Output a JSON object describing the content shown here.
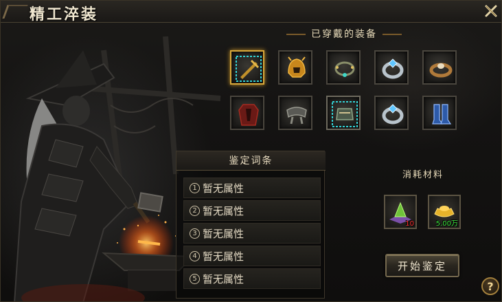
{
  "window": {
    "title": "精工淬装",
    "close_icon": "close-x-icon"
  },
  "equipment": {
    "header": "已穿戴的装备",
    "slots": [
      {
        "icon": "weapon-icon",
        "selected": true
      },
      {
        "icon": "helmet-icon",
        "selected": false
      },
      {
        "icon": "necklace-icon",
        "selected": false
      },
      {
        "icon": "bracelet-icon",
        "selected": false
      },
      {
        "icon": "ring-icon",
        "selected": false
      },
      {
        "icon": "armor-icon",
        "selected": false
      },
      {
        "icon": "belt-icon",
        "selected": false
      },
      {
        "icon": "gauntlet-icon",
        "selected": false
      },
      {
        "icon": "bracer-icon",
        "selected": false
      },
      {
        "icon": "boots-icon",
        "selected": false
      }
    ]
  },
  "attributes": {
    "header": "鉴定词条",
    "rows": [
      {
        "num": "1",
        "text": "暂无属性"
      },
      {
        "num": "2",
        "text": "暂无属性"
      },
      {
        "num": "3",
        "text": "暂无属性"
      },
      {
        "num": "4",
        "text": "暂无属性"
      },
      {
        "num": "5",
        "text": "暂无属性"
      }
    ]
  },
  "materials": {
    "header": "消耗材料",
    "items": [
      {
        "icon": "crystal-pile-icon",
        "count": "10",
        "count_color": "#ff3030"
      },
      {
        "icon": "gold-ingot-icon",
        "count": "5.00万",
        "count_color": "#39e03a"
      }
    ]
  },
  "actions": {
    "start_label": "开始鉴定",
    "help_label": "?"
  }
}
